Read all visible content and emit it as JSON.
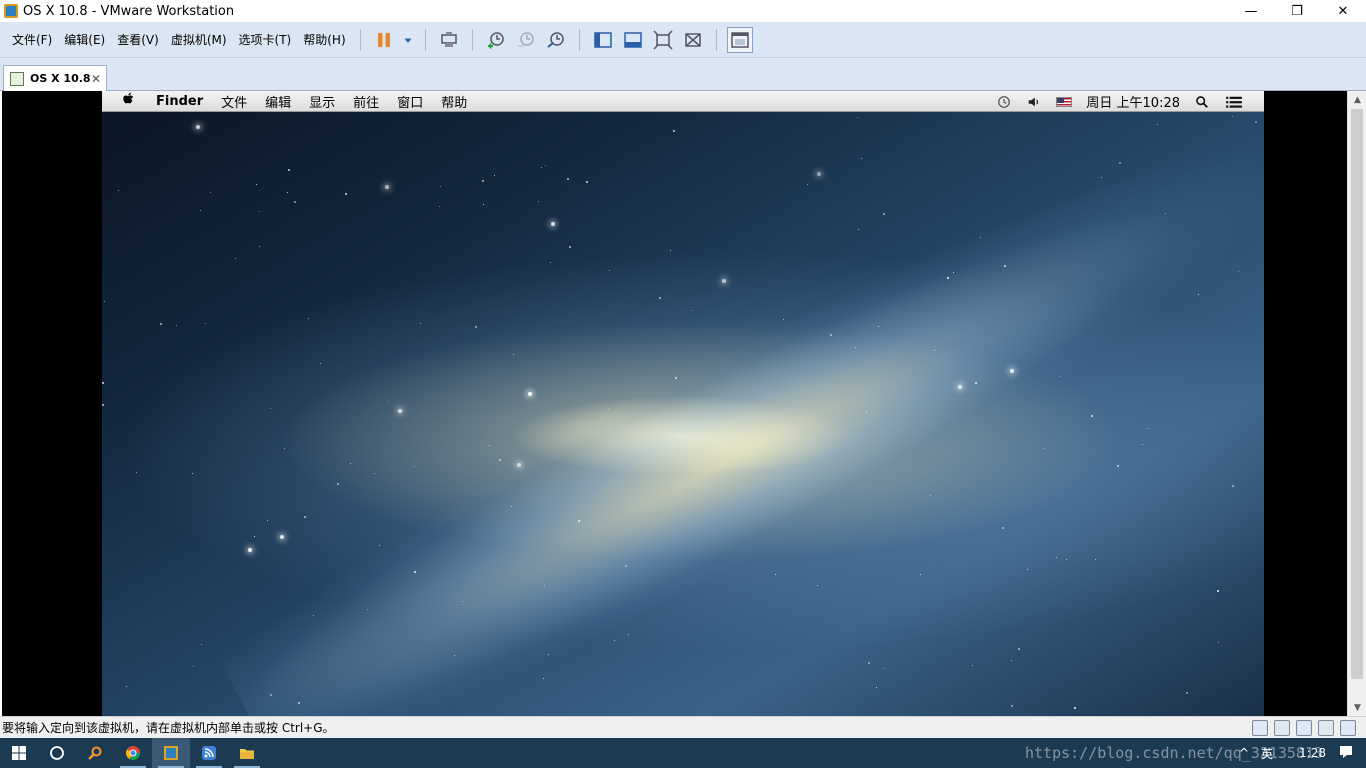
{
  "window": {
    "title": "OS X 10.8 - VMware Workstation",
    "controls": {
      "minimize": "—",
      "restore": "❐",
      "close": "✕"
    }
  },
  "menu": {
    "items": [
      "文件(F)",
      "编辑(E)",
      "查看(V)",
      "虚拟机(M)",
      "选项卡(T)",
      "帮助(H)"
    ]
  },
  "toolbar": {
    "icons": [
      "pause-icon",
      "dropdown-arrow-icon",
      "send-ctrl-alt-del-icon",
      "snapshot-icon",
      "revert-snapshot-icon",
      "snapshot-manager-icon",
      "library-icon",
      "thumbnail-icon",
      "fullscreen-icon",
      "unity-icon",
      "console-view-icon"
    ]
  },
  "tabs": [
    {
      "label": "OS X 10.8",
      "close": "✕"
    }
  ],
  "guest": {
    "menubar": {
      "apple": "",
      "app": "Finder",
      "menus": [
        "文件",
        "编辑",
        "显示",
        "前往",
        "窗口",
        "帮助"
      ],
      "status": {
        "icons": [
          "time-machine-icon",
          "volume-icon",
          "us-flag-icon",
          "spotlight-icon",
          "notification-center-icon"
        ],
        "clock": "周日 上午10:28"
      }
    }
  },
  "statusbar": {
    "message": "要将输入定向到该虚拟机，请在虚拟机内部单击或按 Ctrl+G。",
    "icons": [
      "hard-disk-icon",
      "cd-icon",
      "network-icon",
      "usb-icon",
      "message-icon"
    ]
  },
  "taskbar": {
    "tray": {
      "chevron": "^",
      "ime": "英",
      "time": "1:28"
    },
    "watermark": "https://blog.csdn.net/qq_33135813"
  },
  "colors": {
    "menubar_bg": "#dbe6f4",
    "taskbar_bg": "#1c3a52",
    "pause_accent": "#e8892a"
  }
}
